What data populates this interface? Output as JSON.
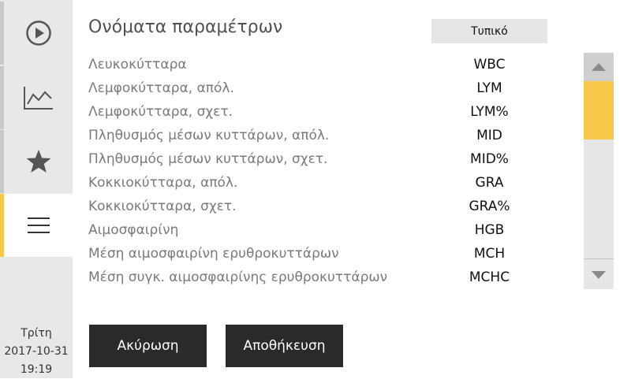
{
  "sidebar": {
    "items": [
      {
        "icon": "play-icon"
      },
      {
        "icon": "chart-icon"
      },
      {
        "icon": "star-icon"
      },
      {
        "icon": "menu-icon",
        "active": true
      }
    ],
    "day": "Τρίτη",
    "date": "2017-10-31",
    "time": "19:19"
  },
  "header": {
    "title": "Ονόματα παραμέτρων",
    "standard_label": "Τυπικό"
  },
  "parameters": [
    {
      "name": "Λευκοκύτταρα",
      "code": "WBC"
    },
    {
      "name": "Λεμφοκύτταρα, απόλ.",
      "code": "LYM"
    },
    {
      "name": "Λεμφοκύτταρα, σχετ.",
      "code": "LYM%"
    },
    {
      "name": "Πληθυσμός μέσων κυττάρων, απόλ.",
      "code": "MID"
    },
    {
      "name": "Πληθυσμός μέσων κυττάρων, σχετ.",
      "code": "MID%"
    },
    {
      "name": "Κοκκιοκύτταρα, απόλ.",
      "code": "GRA"
    },
    {
      "name": "Κοκκιοκύτταρα, σχετ.",
      "code": "GRA%"
    },
    {
      "name": "Αιμοσφαιρίνη",
      "code": "HGB"
    },
    {
      "name": "Μέση αιμοσφαιρίνη ερυθροκυττάρων",
      "code": "MCH"
    },
    {
      "name": "Μέση συγκ. αιμοσφαιρίνης ερυθροκυττάρων",
      "code": "MCHC"
    }
  ],
  "actions": {
    "cancel_label": "Ακύρωση",
    "save_label": "Αποθήκευση"
  },
  "colors": {
    "accent": "#f8c84a",
    "button_dark": "#2a2a2a",
    "sidebar_bg": "#e8e8e8"
  }
}
